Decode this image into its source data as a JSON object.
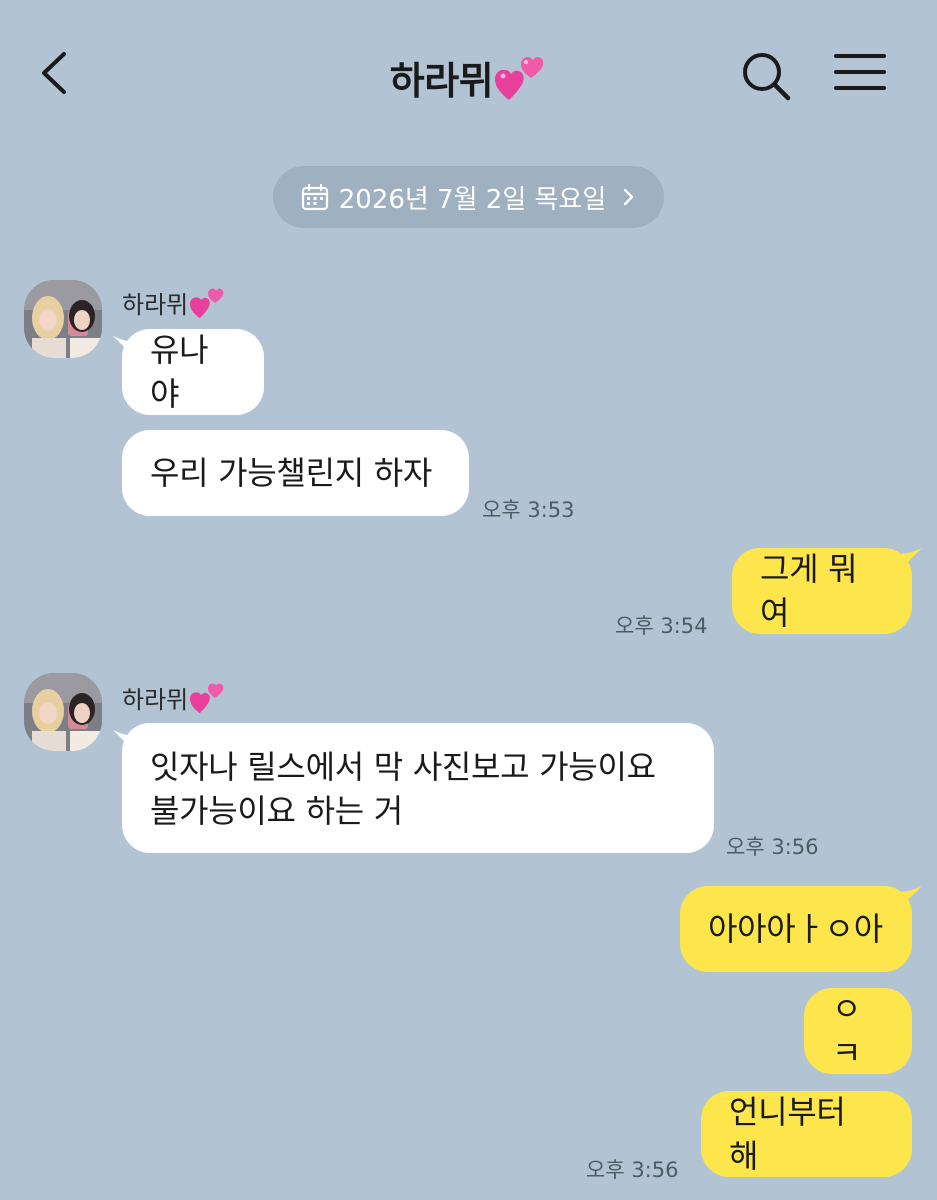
{
  "header": {
    "title": "하라뮈"
  },
  "date_divider": {
    "label": "2026년 7월 2일 목요일"
  },
  "colors": {
    "background": "#b2c4d4",
    "my_bubble": "#fde64b",
    "their_bubble": "#ffffff",
    "date_pill": "#9fb0c0"
  },
  "icons": {
    "back": "chevron-left-icon",
    "search": "search-icon",
    "menu": "hamburger-menu-icon",
    "calendar": "calendar-icon",
    "emoji": "two-hearts-icon"
  },
  "messages": {
    "group1": {
      "sender": "하라뮈",
      "m1": "유나야",
      "m2": "우리 가능챌린지 하자",
      "time": "오후 3:53"
    },
    "group2": {
      "m1": "그게 뭐여",
      "time": "오후 3:54"
    },
    "group3": {
      "sender": "하라뮈",
      "line1": "잇자나 릴스에서 막 사진보고 가능이요",
      "line2": "불가능이요 하는 거",
      "time": "오후 3:56"
    },
    "group4": {
      "m1": "아아아ㅏㅇ아",
      "m2": "ㅇㅋ",
      "m3": "언니부터 해",
      "time": "오후 3:56"
    }
  }
}
